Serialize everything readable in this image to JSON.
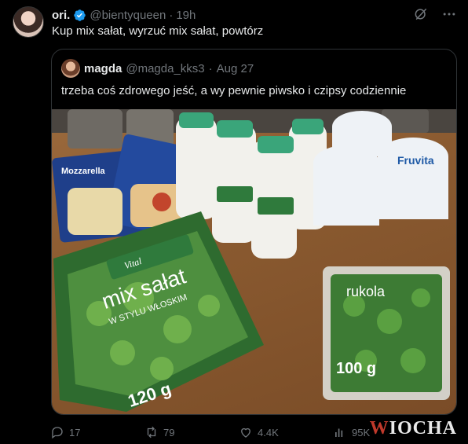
{
  "tweet": {
    "display_name": "ori.",
    "handle": "@bientyqueen",
    "separator": "·",
    "time": "19h",
    "text": "Kup mix sałat, wyrzuć mix sałat, powtórz"
  },
  "quote": {
    "display_name": "magda",
    "handle": "@magda_kks3",
    "separator": "·",
    "time": "Aug 27",
    "text": "trzeba coś zdrowego jeść, a wy pewnie piwsko i czipsy codziennie",
    "photo_labels": {
      "mozzarella": "Mozzarella",
      "mix_salad": "mix sałat",
      "mix_salad_sub": "W STYLU WŁOSKIM",
      "mix_weight": "120 g",
      "rukola": "rukola",
      "rukola_weight": "100 g",
      "fruvita": "Fruvita",
      "vital": "Vital"
    }
  },
  "actions": {
    "replies": "17",
    "reposts": "79",
    "likes": "4.4K",
    "views": "95K"
  },
  "watermark": {
    "w": "W",
    "rest": "IOCHA"
  },
  "colors": {
    "background": "#000000",
    "text_primary": "#e7e9ea",
    "text_secondary": "#71767b",
    "border": "#2f3336",
    "verified": "#1d9bf0"
  }
}
